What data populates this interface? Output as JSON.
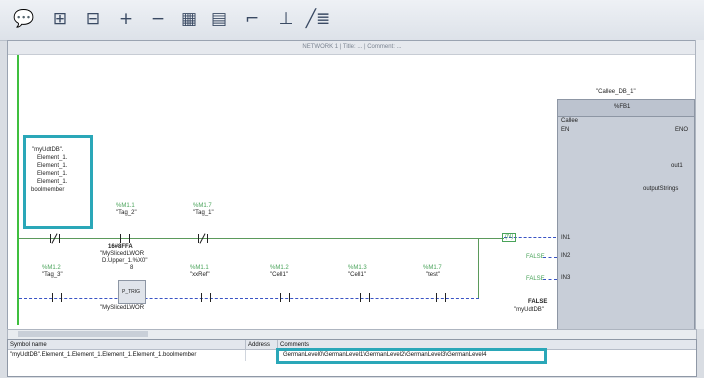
{
  "toolbar": {
    "icons": [
      "comment-bubble-icon",
      "network-open-icon",
      "network-close-icon",
      "zoom-in-icon",
      "zoom-out-icon",
      "insert-network-icon",
      "insert-branch-icon",
      "insert-coil-icon",
      "insert-contact-icon",
      "toggle-symbol-icon"
    ],
    "glyphs": [
      "💬",
      "⊞",
      "⊟",
      "+",
      "−",
      "▦",
      "▤",
      "⌐",
      "⊥",
      "╱≣"
    ]
  },
  "network": {
    "title": "NETWORK 1 | Title: ... | Comment: ..."
  },
  "operand": {
    "lines": [
      "\"myUdtDB\".",
      "Element_1.",
      "Element_1.",
      "Element_1.",
      "Element_1.",
      "boolmember"
    ]
  },
  "rung1": {
    "contact1": {
      "addr": "%M1.1",
      "name": "\"Tag_2\""
    },
    "contact2": {
      "addr": "%M1.7",
      "name": "\"Tag_1\""
    },
    "slice_val": "16#8FFA",
    "slice_label": "\"MySlicedLWOR",
    "slice_label2": "D.Upper_1.%X0\"",
    "slice_label3": "8",
    "coil_box": "(N)"
  },
  "rung2": {
    "c0": {
      "addr": "%M1.2",
      "name": "\"Tag_3\""
    },
    "ctr": {
      "addr": "P_TRIG",
      "name": "\"MySlicedLWOR"
    },
    "c1": {
      "addr": "%M1.1",
      "name": "\"xxRef\""
    },
    "c2": {
      "addr": "%M1.2",
      "name": "\"Cell1\""
    },
    "c3": {
      "addr": "%M1.3",
      "name": "\"Cell1\""
    },
    "c4": {
      "addr": "%M1.7",
      "name": "\"test\""
    }
  },
  "fb": {
    "instance": "\"Callee_DB_1\"",
    "type": "%FB1",
    "name": "Callee",
    "en": "EN",
    "eno": "ENO",
    "out1": "out1",
    "outputStrings": "outputStrings",
    "in1": "IN1",
    "in2": "IN2",
    "in3": "IN3",
    "false_const": "FALSE",
    "false_target": "\"myUdtDB\"",
    "false_in1": "FALSE",
    "false_in2": "FALSE"
  },
  "table": {
    "headers": [
      "Symbol name",
      "Address",
      "Comments"
    ],
    "row": {
      "symbol": "\"myUdtDB\".Element_1.Element_1.Element_1.Element_1.boolmember",
      "address": "",
      "comment": "GermanLevel0\\GermanLevel1\\GermanLevel2\\GermanLevel3\\GermanLevel4"
    }
  }
}
